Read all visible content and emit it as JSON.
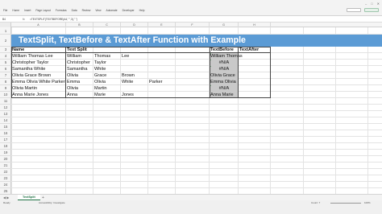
{
  "ribbon": {
    "tabs": [
      "File",
      "Home",
      "Insert",
      "Page Layout",
      "Formulas",
      "Data",
      "Review",
      "View",
      "Automate",
      "Developer",
      "Help"
    ]
  },
  "formula_bar": {
    "name_box": "B4",
    "fx": "fx",
    "formula": "=TEXTSPLIT(TEXTBEFORE(A4,\" \",3),\" \")"
  },
  "columns": [
    "A",
    "B",
    "C",
    "D",
    "E",
    "F",
    "G",
    "H"
  ],
  "rows": [
    "1",
    "2",
    "3",
    "4",
    "5",
    "6",
    "7",
    "8",
    "9",
    "10",
    "11",
    "12",
    "13",
    "14",
    "15",
    "16",
    "17",
    "18",
    "19",
    "20",
    "21",
    "22",
    "23",
    "24",
    "25"
  ],
  "title": "TextSplit, TextBefore & TextAfter Function with Example",
  "table": {
    "headers": {
      "name": "Name",
      "text_split": "Text Split",
      "text_before": "TextBefore",
      "text_after": "TextAfter"
    },
    "rows": [
      {
        "name": "William Thomas Lee",
        "split": [
          "William",
          "Thomas",
          "Lee",
          ""
        ],
        "before": "William Thomas"
      },
      {
        "name": "Christopher Taylor",
        "split": [
          "Christopher",
          "Taylor",
          "",
          ""
        ],
        "before": "#N/A"
      },
      {
        "name": "Samantha White",
        "split": [
          "Samantha",
          "White",
          "",
          ""
        ],
        "before": "#N/A"
      },
      {
        "name": "Olivia Grace Brown",
        "split": [
          "Olivia",
          "Grace",
          "Brown",
          ""
        ],
        "before": "Olivia Grace"
      },
      {
        "name": "Emma Olivia White Parker",
        "split": [
          "Emma",
          "Olivia",
          "White",
          "Parker"
        ],
        "before": "Emma Olivia"
      },
      {
        "name": "Olivia Martin",
        "split": [
          "Olivia",
          "Martin",
          "",
          ""
        ],
        "before": "#N/A"
      },
      {
        "name": "Anna Marie Jones",
        "split": [
          "Anna",
          "Marie",
          "Jones",
          ""
        ],
        "before": "Anna Marie"
      }
    ]
  },
  "sheet": {
    "tab_label": "TextSplit",
    "add_symbol": "+"
  },
  "status": {
    "ready": "Ready",
    "accessibility": "Accessibility: Investigate",
    "count": "Count: 7",
    "zoom": "100%"
  },
  "colors": {
    "banner": "#5b9bd5",
    "error_triangle": "#2e8b3d",
    "selection_shade": "#c9c9c9",
    "excel_green": "#217346"
  }
}
